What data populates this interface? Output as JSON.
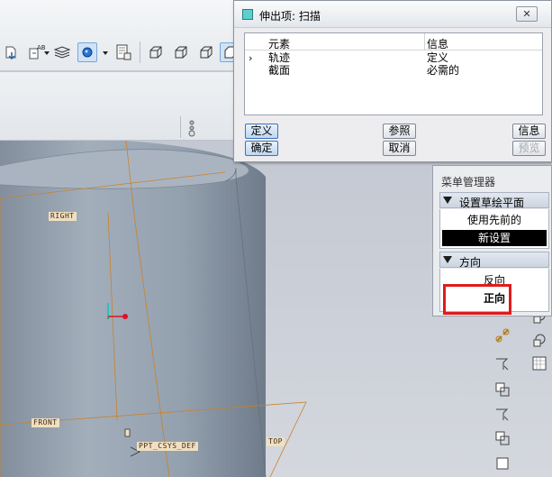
{
  "sweep_dialog": {
    "title": "伸出项: 扫描",
    "close_symbol": "✕",
    "columns": [
      "元素",
      "信息"
    ],
    "rows": [
      {
        "marker": "›",
        "element": "轨迹",
        "info": "定义"
      },
      {
        "marker": "",
        "element": "截面",
        "info": "必需的"
      }
    ],
    "buttons": {
      "define": "定义",
      "reference": "参照",
      "info": "信息",
      "ok": "确定",
      "cancel": "取消",
      "preview": "预览"
    }
  },
  "menu_manager": {
    "title": "菜单管理器",
    "sketch_plane_header": "设置草绘平面",
    "sketch_plane_items": [
      "使用先前的",
      "新设置"
    ],
    "direction_header": "方向",
    "direction_items": [
      "反向",
      "正向"
    ]
  },
  "viewport": {
    "datum_labels": {
      "right": "RIGHT",
      "front": "FRONT",
      "top": "TOP",
      "csys": "PPT_CSYS_DEF"
    }
  },
  "colors": {
    "highlight": "#e01b1b",
    "datum_line": "#c9822a",
    "cylinder": "#9aa6b3"
  }
}
